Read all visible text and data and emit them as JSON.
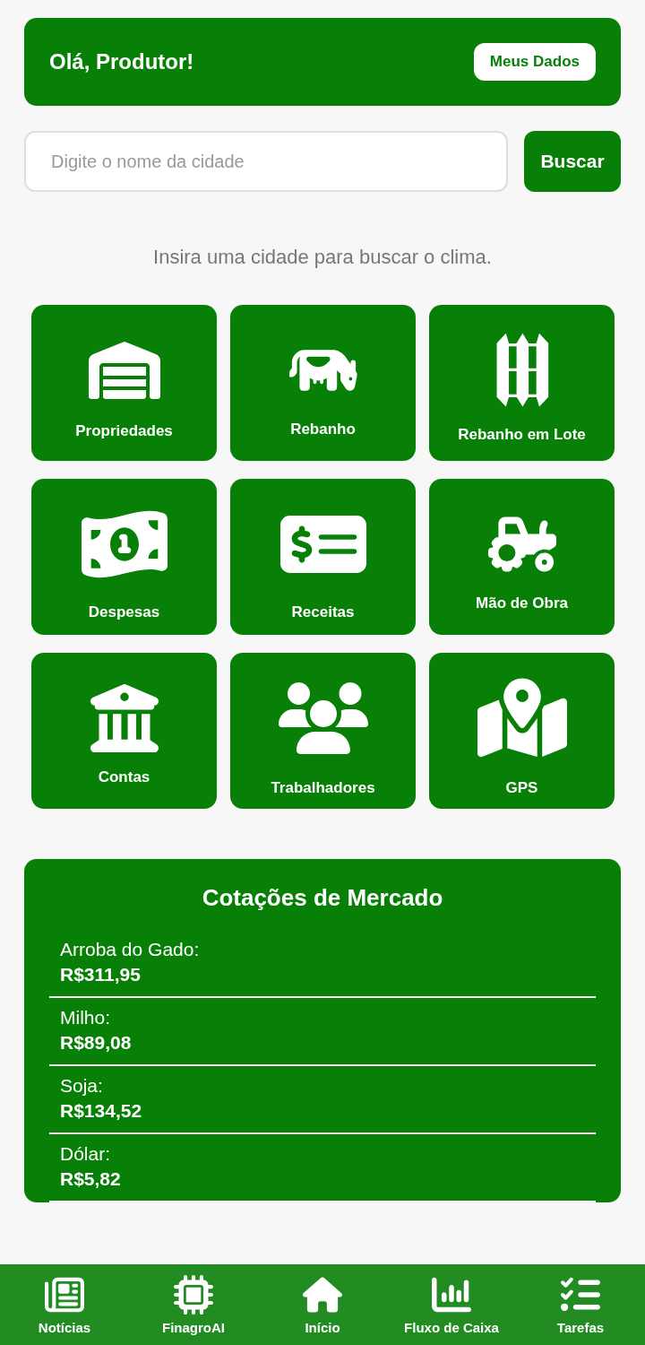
{
  "header": {
    "greeting": "Olá, Produtor!",
    "button": "Meus Dados"
  },
  "search": {
    "placeholder": "Digite o nome da cidade",
    "button": "Buscar"
  },
  "weather_message": "Insira uma cidade para buscar o clima.",
  "tiles": [
    {
      "label": "Propriedades"
    },
    {
      "label": "Rebanho"
    },
    {
      "label": "Rebanho em Lote"
    },
    {
      "label": "Despesas"
    },
    {
      "label": "Receitas"
    },
    {
      "label": "Mão de Obra"
    },
    {
      "label": "Contas"
    },
    {
      "label": "Trabalhadores"
    },
    {
      "label": "GPS"
    }
  ],
  "market": {
    "title": "Cotações de Mercado",
    "quotes": [
      {
        "name": "Arroba do Gado:",
        "price": "R$311,95"
      },
      {
        "name": "Milho:",
        "price": "R$89,08"
      },
      {
        "name": "Soja:",
        "price": "R$134,52"
      },
      {
        "name": "Dólar:",
        "price": "R$5,82"
      }
    ]
  },
  "bottom_nav": [
    {
      "label": "Notícias"
    },
    {
      "label": "FinagroAI"
    },
    {
      "label": "Início"
    },
    {
      "label": "Fluxo de Caixa"
    },
    {
      "label": "Tarefas"
    }
  ]
}
